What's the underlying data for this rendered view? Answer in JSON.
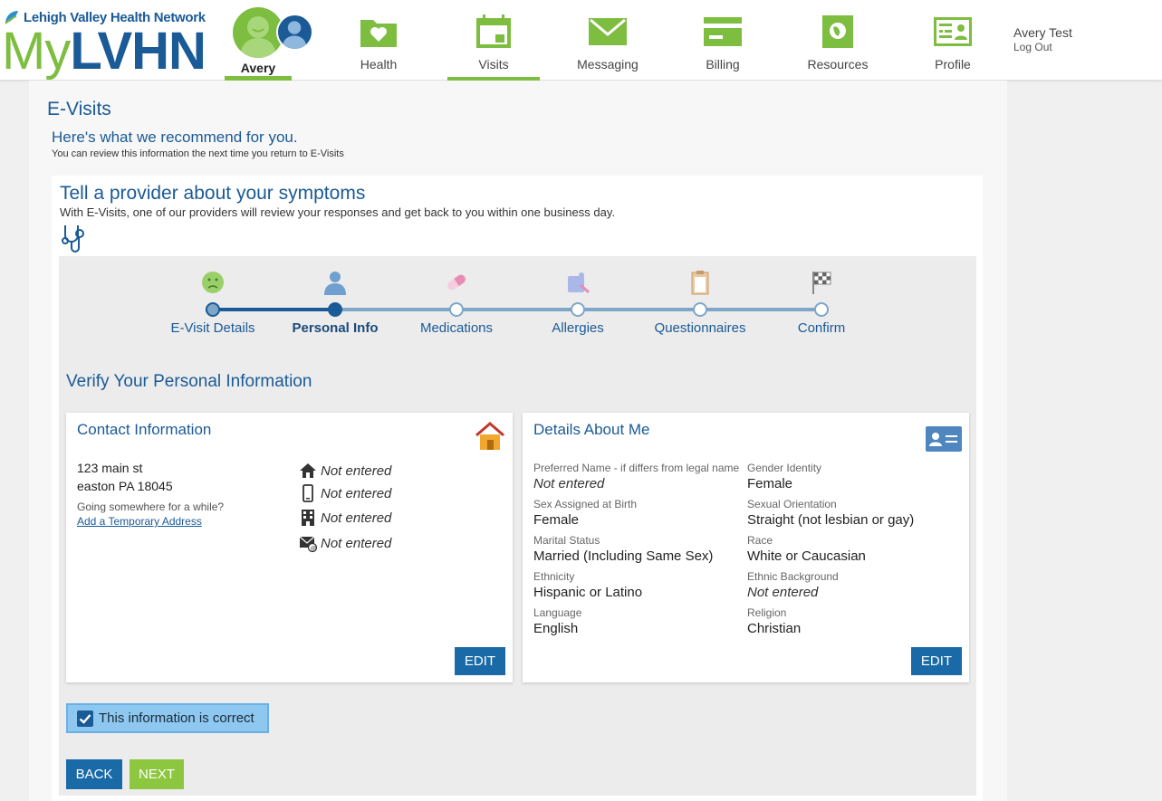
{
  "header": {
    "org_name": "Lehigh Valley Health Network",
    "logo_my": "My",
    "logo_lvhn": "LVHN",
    "avatar_name": "Avery",
    "nav": [
      {
        "label": "Health",
        "icon": "health-folder-icon",
        "active": false
      },
      {
        "label": "Visits",
        "icon": "calendar-icon",
        "active": true
      },
      {
        "label": "Messaging",
        "icon": "envelope-icon",
        "active": false
      },
      {
        "label": "Billing",
        "icon": "credit-card-icon",
        "active": false
      },
      {
        "label": "Resources",
        "icon": "globe-book-icon",
        "active": false
      },
      {
        "label": "Profile",
        "icon": "id-card-icon",
        "active": false
      }
    ],
    "user_name": "Avery Test",
    "logout_label": "Log Out"
  },
  "page": {
    "title": "E-Visits",
    "recommend": "Here's what we recommend for you.",
    "recommend_sub": "You can review this information the next time you return to E-Visits"
  },
  "card": {
    "title": "Tell a provider about your symptoms",
    "subtitle": "With E-Visits, one of our providers will review your responses and get back to you within one business day."
  },
  "steps": [
    {
      "label": "E-Visit Details",
      "state": "done",
      "icon": "sick-face-icon"
    },
    {
      "label": "Personal Info",
      "state": "current",
      "icon": "person-icon"
    },
    {
      "label": "Medications",
      "state": "todo",
      "icon": "pill-icon"
    },
    {
      "label": "Allergies",
      "state": "todo",
      "icon": "allergy-icon"
    },
    {
      "label": "Questionnaires",
      "state": "todo",
      "icon": "clipboard-icon"
    },
    {
      "label": "Confirm",
      "state": "todo",
      "icon": "checkered-flag-icon"
    }
  ],
  "section_title": "Verify Your Personal Information",
  "contact": {
    "title": "Contact Information",
    "address_line1": "123 main st",
    "address_line2": "easton PA 18045",
    "going": "Going somewhere for a while?",
    "temp_link": "Add a Temporary Address",
    "home_phone": "Not entered",
    "mobile_phone": "Not entered",
    "work_phone": "Not entered",
    "email": "Not entered",
    "edit": "EDIT"
  },
  "details": {
    "title": "Details About Me",
    "fields": [
      {
        "label": "Preferred Name - if differs from legal name",
        "value": "Not entered",
        "empty": true
      },
      {
        "label": "Gender Identity",
        "value": "Female",
        "empty": false
      },
      {
        "label": "Sex Assigned at Birth",
        "value": "Female",
        "empty": false
      },
      {
        "label": "Sexual Orientation",
        "value": "Straight (not lesbian or gay)",
        "empty": false
      },
      {
        "label": "Marital Status",
        "value": "Married (Including Same Sex)",
        "empty": false
      },
      {
        "label": "Race",
        "value": "White or Caucasian",
        "empty": false
      },
      {
        "label": "Ethnicity",
        "value": "Hispanic or Latino",
        "empty": false
      },
      {
        "label": "Ethnic Background",
        "value": "Not entered",
        "empty": true
      },
      {
        "label": "Language",
        "value": "English",
        "empty": false
      },
      {
        "label": "Religion",
        "value": "Christian",
        "empty": false
      }
    ],
    "edit": "EDIT"
  },
  "confirm_label": "This information is correct",
  "confirm_checked": true,
  "buttons": {
    "back": "BACK",
    "next": "NEXT"
  },
  "colors": {
    "brand_blue": "#1a5a96",
    "brand_green": "#7dbd3f",
    "button_blue": "#1a6aa8",
    "next_green": "#8dc63f"
  }
}
